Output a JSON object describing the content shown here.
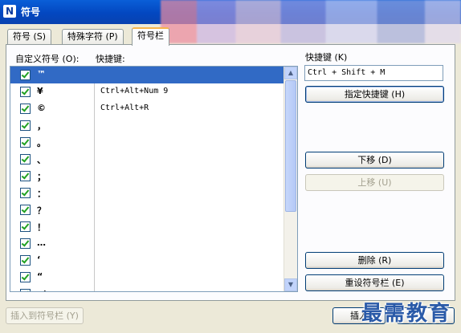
{
  "window": {
    "title": "符号",
    "icon_glyph": "N"
  },
  "tabs": [
    {
      "label": "符号 (S)"
    },
    {
      "label": "特殊字符 (P)"
    },
    {
      "label": "符号栏"
    }
  ],
  "list": {
    "header_symbol": "自定义符号 (O):",
    "header_shortcut": "快捷键:",
    "rows": [
      {
        "symbol": "™",
        "shortcut": "",
        "checked": true
      },
      {
        "symbol": "¥",
        "shortcut": "Ctrl+Alt+Num 9",
        "checked": true
      },
      {
        "symbol": "©",
        "shortcut": "Ctrl+Alt+R",
        "checked": true
      },
      {
        "symbol": "，",
        "shortcut": "",
        "checked": true
      },
      {
        "symbol": "。",
        "shortcut": "",
        "checked": true
      },
      {
        "symbol": "、",
        "shortcut": "",
        "checked": true
      },
      {
        "symbol": "；",
        "shortcut": "",
        "checked": true
      },
      {
        "symbol": "：",
        "shortcut": "",
        "checked": true
      },
      {
        "symbol": "？",
        "shortcut": "",
        "checked": true
      },
      {
        "symbol": "！",
        "shortcut": "",
        "checked": true
      },
      {
        "symbol": "…",
        "shortcut": "",
        "checked": true
      },
      {
        "symbol": "‘",
        "shortcut": "",
        "checked": true
      },
      {
        "symbol": "“",
        "shortcut": "",
        "checked": true
      },
      {
        "symbol": "（",
        "shortcut": "",
        "checked": true
      }
    ]
  },
  "shortcut": {
    "label": "快捷键 (K)",
    "value": "Ctrl + Shift + M",
    "assign_button": "指定快捷键 (H)"
  },
  "buttons": {
    "move_down": "下移 (D)",
    "move_up": "上移 (U)",
    "delete": "删除 (R)",
    "reset": "重设符号栏 (E)",
    "insert_to_bar": "插入到符号栏 (Y)",
    "insert": "插入"
  },
  "watermark": "最需教育"
}
